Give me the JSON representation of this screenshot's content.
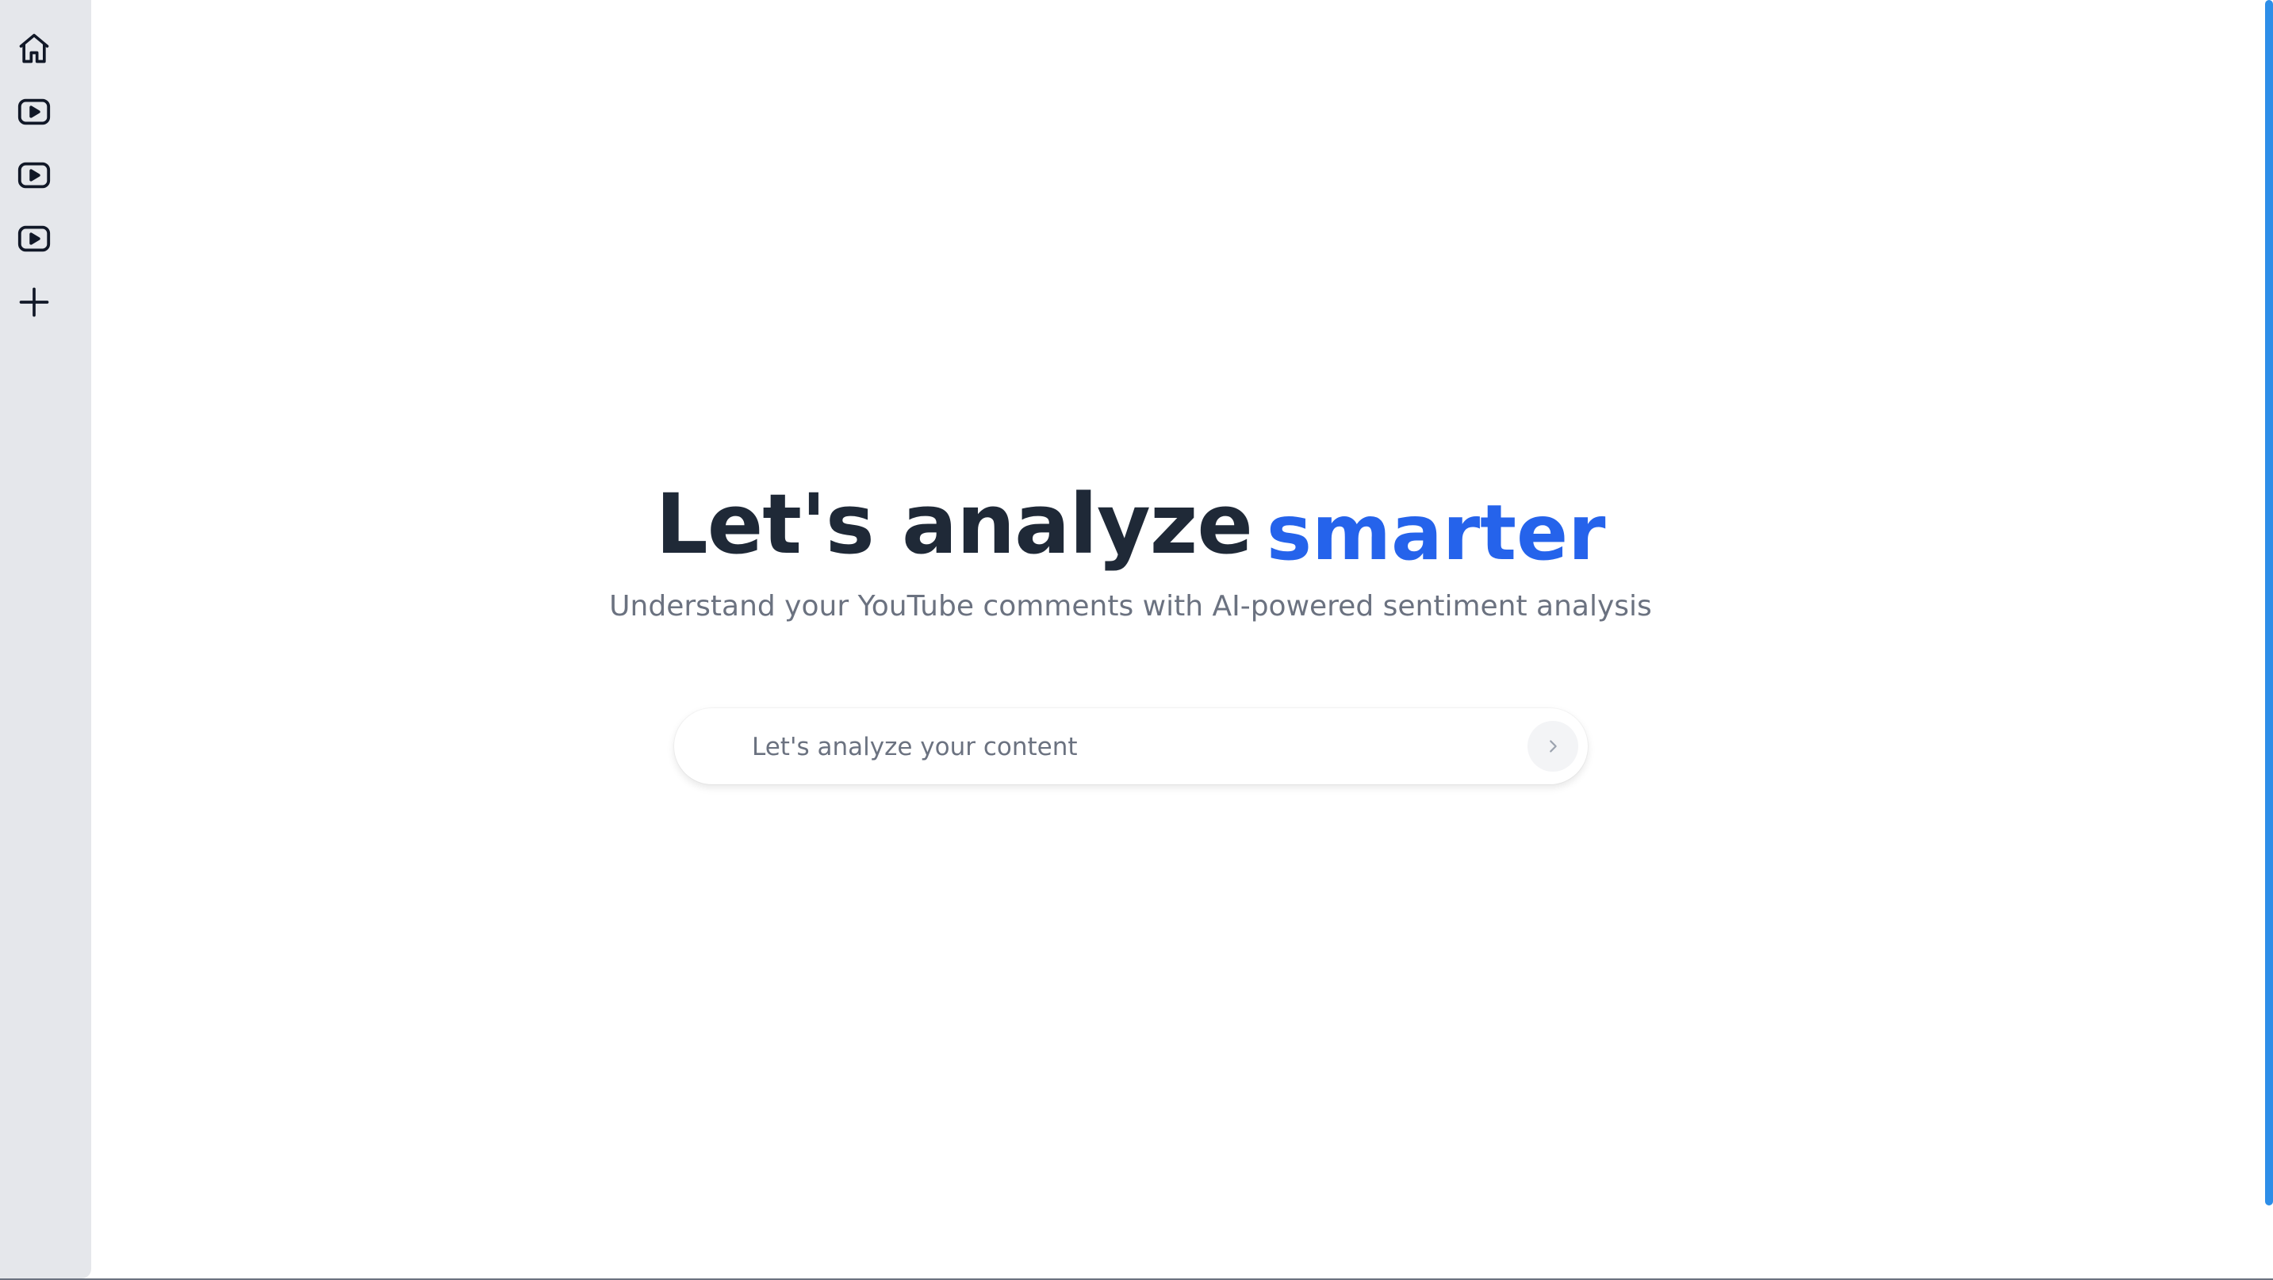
{
  "sidebar": {
    "items": [
      {
        "icon": "home-icon"
      },
      {
        "icon": "youtube-play-icon"
      },
      {
        "icon": "youtube-play-icon"
      },
      {
        "icon": "youtube-play-icon"
      },
      {
        "icon": "plus-icon"
      }
    ]
  },
  "hero": {
    "title_main": "Let's analyze",
    "title_accent": "smarter",
    "subtitle": "Understand your YouTube comments with AI-powered sentiment analysis"
  },
  "search": {
    "value": "",
    "placeholder": "Let's analyze your content",
    "submit_icon": "chevron-right-icon"
  },
  "colors": {
    "accent": "#2563eb",
    "heading": "#1f2937",
    "muted": "#6b7280",
    "sidebar_bg": "#e5e7eb",
    "scrollbar": "#2d8ee8"
  }
}
